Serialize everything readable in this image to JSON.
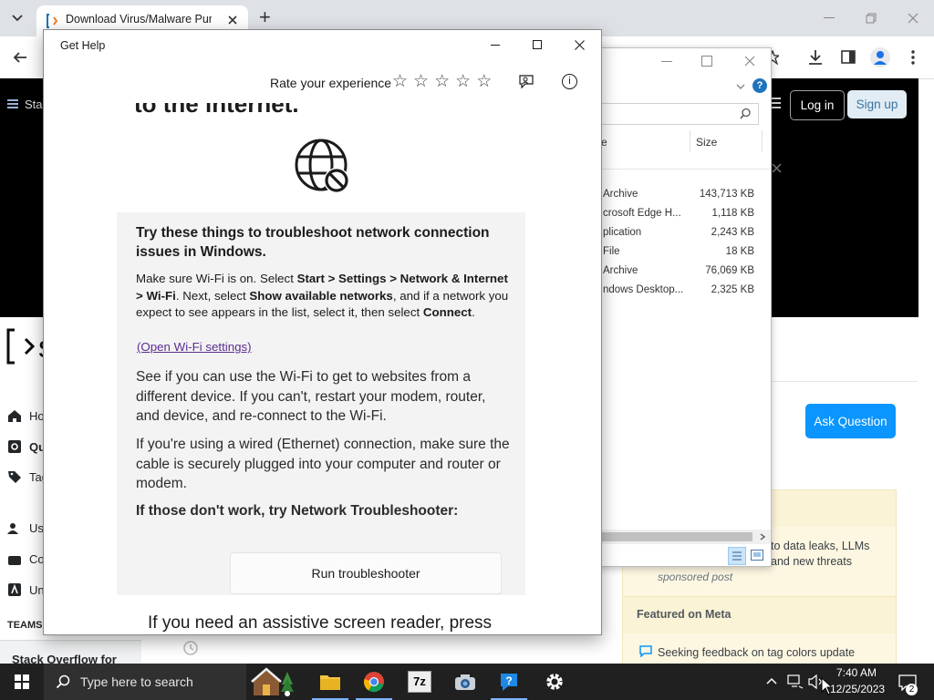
{
  "browser": {
    "tab_title": "Download Virus/Malware Purpose",
    "new_tab_symbol": "+",
    "login_label": "Log in",
    "signup_label": "Sign up",
    "nav_label_fragment": "Stac"
  },
  "so": {
    "nav": [
      "Ho",
      "Qu",
      "Tag",
      "Us",
      "Co",
      "Un"
    ],
    "teams_label": "TEAMS",
    "teams_text": "Stack Overflow for",
    "logo_fragment": "s",
    "ask_question": "Ask Question",
    "blog_line1": "to data leaks, LLMs",
    "blog_line2": "and new threats",
    "sponsored": "sponsored post",
    "featured_meta": "Featured on Meta",
    "meta_item": "Seeking feedback on tag colors update"
  },
  "explorer": {
    "col_name": "e",
    "col_size": "Size",
    "rows": [
      {
        "type": "Archive",
        "size": "143,713 KB"
      },
      {
        "type": "crosoft Edge H...",
        "size": "1,118 KB"
      },
      {
        "type": "plication",
        "size": "2,243 KB"
      },
      {
        "type": "File",
        "size": "18 KB"
      },
      {
        "type": "Archive",
        "size": "76,069 KB"
      },
      {
        "type": "ndows Desktop...",
        "size": "2,325 KB"
      }
    ],
    "help_symbol": "?"
  },
  "gethelp": {
    "title": "Get Help",
    "rate_label": "Rate your experience",
    "stars": [
      "☆",
      "☆",
      "☆",
      "☆",
      "☆"
    ],
    "info_symbol": "i",
    "heading_cut": "to the internet.",
    "card_heading": "Try these things to troubleshoot network connection issues in Windows.",
    "wifi": {
      "p1": "Make sure Wi-Fi is on. Select ",
      "b1": "Start > Settings > Network & Internet > Wi-Fi",
      "p2": ". Next, select ",
      "b2": "Show available networks",
      "p3": ", and if a network you expect to see appears in the list, select it, then select ",
      "b3": "Connect",
      "p4": "."
    },
    "wifi_link": "(Open Wi-Fi settings)",
    "para2": "See if you can use the Wi-Fi to get to websites from a different device. If you can't, restart your modem, router, and device, and re-connect to the Wi-Fi.",
    "para3": "If you're using a wired (Ethernet) connection, make sure the cable is securely plugged into your computer and router or modem.",
    "para4": "If those don't work, try Network Troubleshooter:",
    "run_button": "Run troubleshooter",
    "footer_cut": "If you need an assistive screen reader, press"
  },
  "taskbar": {
    "search_placeholder": "Type here to search",
    "time": "7:40 AM",
    "date": "12/25/2023",
    "notification_count": "2",
    "seven_zip_label": "7z"
  },
  "colors": {
    "accent": "#0095ff",
    "so_button": "#0a95ff",
    "taskbar": "#202020",
    "link_purple": "#5c2d91"
  }
}
